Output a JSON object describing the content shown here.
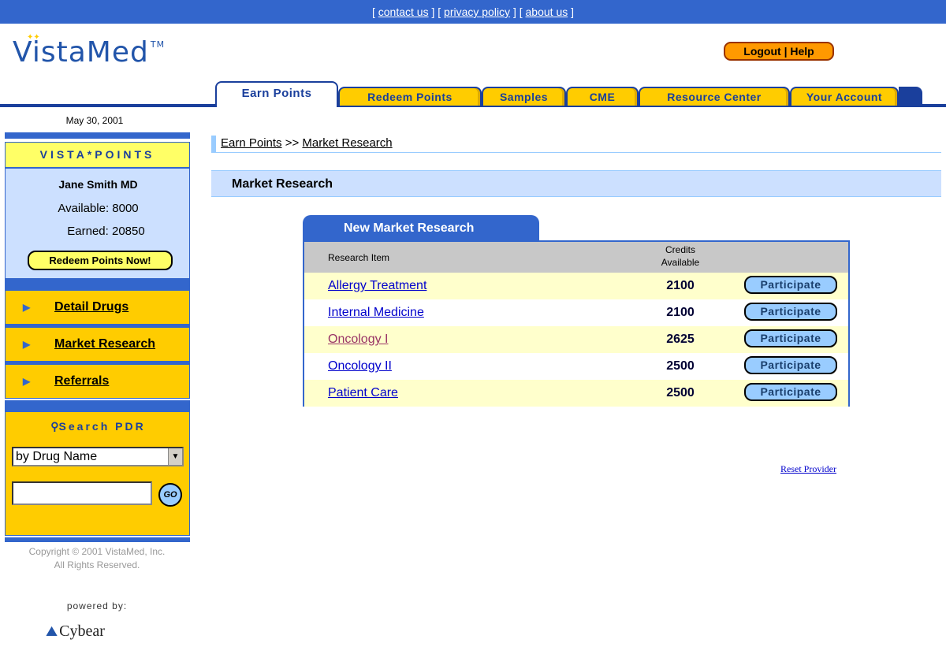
{
  "top_links": {
    "contact": "contact us",
    "privacy": "privacy policy",
    "about": "about us"
  },
  "brand": {
    "name": "VistaMed",
    "tm": "TM"
  },
  "header": {
    "logout_help": "Logout | Help"
  },
  "tabs": [
    {
      "label": "Earn Points",
      "active": true
    },
    {
      "label": "Redeem Points"
    },
    {
      "label": "Samples"
    },
    {
      "label": "CME"
    },
    {
      "label": "Resource Center"
    },
    {
      "label": "Your Account"
    }
  ],
  "sidebar": {
    "date": "May 30, 2001",
    "points_title": "VISTA*POINTS",
    "user_name": "Jane Smith MD",
    "available": "Available: 8000",
    "earned": "Earned: 20850",
    "redeem_button": "Redeem Points Now!",
    "nav": [
      {
        "label": "Detail Drugs"
      },
      {
        "label": "Market Research"
      },
      {
        "label": "Referrals"
      }
    ],
    "search_title": "Search PDR",
    "search_select": "by Drug Name",
    "search_input": "",
    "go_button": "GO",
    "copyright_line1": "Copyright © 2001 VistaMed, Inc.",
    "copyright_line2": "All Rights Reserved.",
    "powered_by": "powered by:",
    "partner": "Cybear"
  },
  "breadcrumb": {
    "parent": "Earn Points",
    "separator": ">>",
    "current": "Market Research"
  },
  "main": {
    "section_title": "Market Research",
    "panel_title": "New Market Research",
    "col_item": "Research Item",
    "col_credits_line1": "Credits",
    "col_credits_line2": "Available",
    "rows": [
      {
        "item": "Allergy Treatment",
        "credits": "2100",
        "action": "Participate"
      },
      {
        "item": "Internal Medicine",
        "credits": "2100",
        "action": "Participate"
      },
      {
        "item": "Oncology I",
        "credits": "2625",
        "action": "Participate"
      },
      {
        "item": "Oncology II",
        "credits": "2500",
        "action": "Participate"
      },
      {
        "item": "Patient Care",
        "credits": "2500",
        "action": "Participate"
      }
    ],
    "reset_provider": "Reset Provider"
  },
  "colors": {
    "brand_blue": "#3366cc",
    "dark_blue": "#1a3f9c",
    "gold": "#ffcc00",
    "light_blue": "#cce0ff",
    "pale_yellow": "#ffffcc"
  }
}
